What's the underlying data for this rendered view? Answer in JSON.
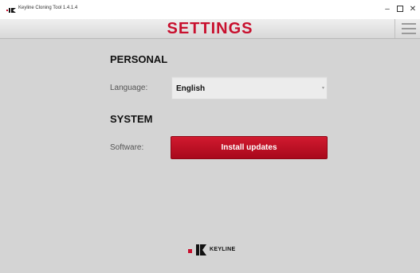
{
  "window": {
    "title": "Keyline Cloning Tool 1.4.1.4",
    "minimize_label": "–",
    "close_label": "✕"
  },
  "header": {
    "title": "SETTINGS",
    "menu_icon": "hamburger-menu-icon"
  },
  "personal": {
    "section_title": "PERSONAL",
    "language_label": "Language:",
    "language_value": "English"
  },
  "system": {
    "section_title": "SYSTEM",
    "software_label": "Software:",
    "install_button_label": "Install updates"
  },
  "footer": {
    "brand_text": "KEYLINE"
  },
  "colors": {
    "brand_red": "#c8102e",
    "background": "#d4d4d4"
  }
}
